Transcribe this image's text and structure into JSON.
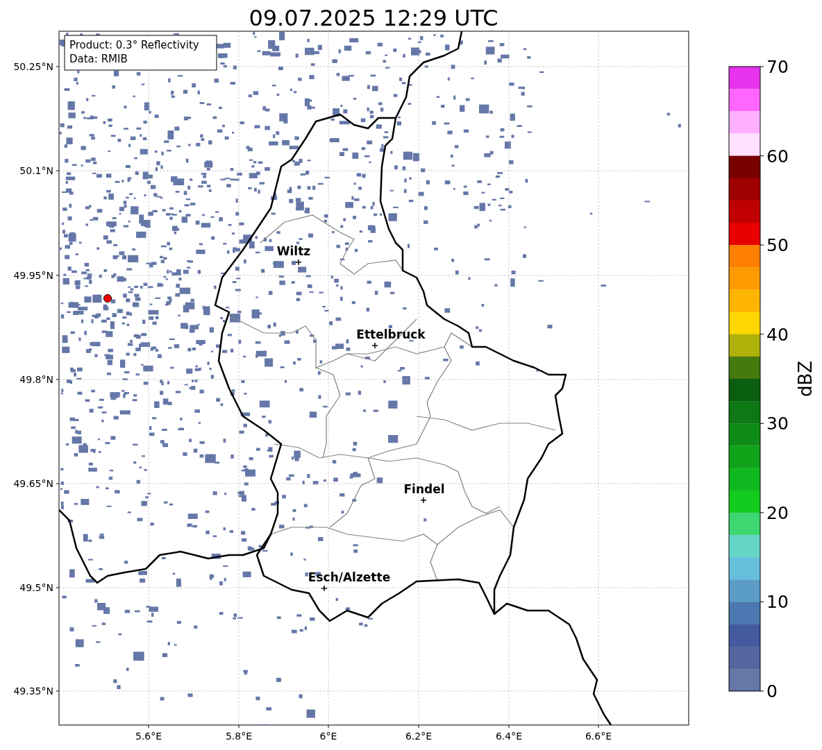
{
  "title": "09.07.2025 12:29 UTC",
  "legend": [
    "Product: 0.3° Reflectivity",
    "Data: RMIB"
  ],
  "y_axis": {
    "ticks": [
      "50.25°N",
      "50.1°N",
      "49.95°N",
      "49.8°N",
      "49.65°N",
      "49.5°N",
      "49.35°N"
    ]
  },
  "x_axis": {
    "ticks": [
      "5.6°E",
      "5.8°E",
      "6°E",
      "6.2°E",
      "6.4°E",
      "6.6°E"
    ]
  },
  "cities": [
    {
      "name": "Wiltz"
    },
    {
      "name": "Ettelbruck"
    },
    {
      "name": "Findel"
    },
    {
      "name": "Esch/Alzette"
    }
  ],
  "colorbar": {
    "label": "dBZ",
    "ticks": [
      "70",
      "60",
      "50",
      "40",
      "30",
      "20",
      "10",
      "0"
    ],
    "bins": [
      {
        "color": "#e633ee"
      },
      {
        "color": "#ff66ff"
      },
      {
        "color": "#ffb0ff"
      },
      {
        "color": "#ffe0ff"
      },
      {
        "color": "#7a0000"
      },
      {
        "color": "#a00000"
      },
      {
        "color": "#c00000"
      },
      {
        "color": "#e60000"
      },
      {
        "color": "#ff7f00"
      },
      {
        "color": "#ff9a00"
      },
      {
        "color": "#ffb400"
      },
      {
        "color": "#ffd700"
      },
      {
        "color": "#afb20a"
      },
      {
        "color": "#457a0f"
      },
      {
        "color": "#0a5e0f"
      },
      {
        "color": "#0d7814"
      },
      {
        "color": "#0f8c17"
      },
      {
        "color": "#10a31a"
      },
      {
        "color": "#10b81f"
      },
      {
        "color": "#14cc1e"
      },
      {
        "color": "#3dd670"
      },
      {
        "color": "#66d7c7"
      },
      {
        "color": "#66c0dc"
      },
      {
        "color": "#5a9cc6"
      },
      {
        "color": "#4b78b0"
      },
      {
        "color": "#435a9e"
      },
      {
        "color": "#54669e"
      },
      {
        "color": "#6677a8"
      }
    ]
  }
}
